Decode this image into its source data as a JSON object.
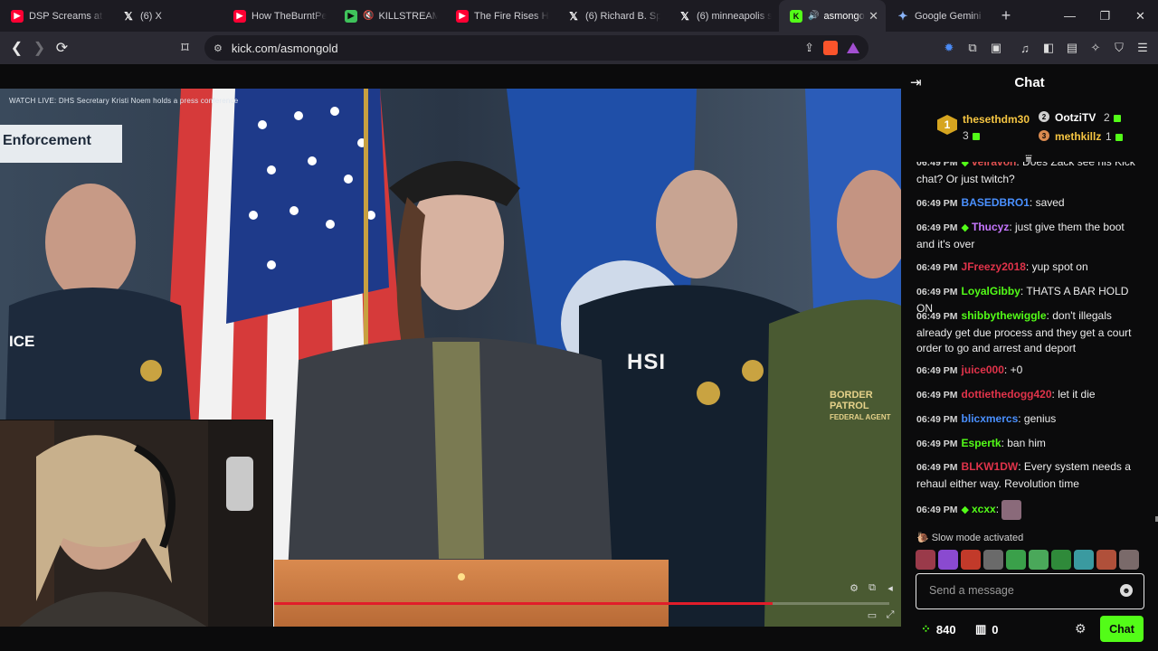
{
  "browser": {
    "tabs": [
      {
        "label": "DSP Screams at H",
        "icon": "youtube-icon"
      },
      {
        "label": "(6) X",
        "icon": "x-icon"
      },
      {
        "label": "How TheBurntPea",
        "icon": "youtube-icon"
      },
      {
        "label": "KILLSTREAM: F",
        "icon": "rumble-icon",
        "muted": true
      },
      {
        "label": "The Fire Rises HO",
        "icon": "youtube-icon"
      },
      {
        "label": "(6) Richard B. Spe",
        "icon": "x-icon"
      },
      {
        "label": "(6) minneapolis sh",
        "icon": "x-icon"
      },
      {
        "label": "asmongol",
        "icon": "kick-icon",
        "active": true
      },
      {
        "label": "Google Gemini",
        "icon": "gemini-icon"
      }
    ],
    "url": "kick.com/asmongold"
  },
  "video": {
    "live_caption": "WATCH LIVE: DHS Secretary Kristi Noem holds a press conference",
    "sign_text": "Enforcement",
    "jacket_hsi": "HSI",
    "jacket_ice": "ICE",
    "patch_line1": "BORDER PATROL",
    "patch_line2": "FEDERAL AGENT",
    "progress_percent": 81
  },
  "chat": {
    "title": "Chat",
    "leaderboard": {
      "rank": "1",
      "top_user": "thesethdm30",
      "top_count": "3",
      "second_user": "OotziTV",
      "second_count": "2",
      "third_user": "methkillz",
      "third_count": "1"
    },
    "messages": [
      {
        "time": "06:49 PM",
        "user": "veiravon",
        "user_color": "#e05050",
        "text": "Does Zack see his Kick chat? Or just twitch?",
        "sub": true
      },
      {
        "time": "06:49 PM",
        "user": "BASEDBRO1",
        "user_color": "#4a90ff",
        "text": "saved"
      },
      {
        "time": "06:49 PM",
        "user": "Thucyz",
        "user_color": "#c777ff",
        "text": "just give them the boot and it's over",
        "sub": true
      },
      {
        "time": "06:49 PM",
        "user": "JFreezy2018",
        "user_color": "#e0334a",
        "text": "yup spot on"
      },
      {
        "time": "06:49 PM",
        "user": "LoyalGibby",
        "user_color": "#53fc18",
        "text": "THATS A BAR HOLD ON"
      },
      {
        "time": "06:49 PM",
        "user": "shibbythewiggle",
        "user_color": "#53fc18",
        "text": "don't illegals already get due process and they get a court order to go and arrest and deport"
      },
      {
        "time": "06:49 PM",
        "user": "juice000",
        "user_color": "#e0334a",
        "text": "+0"
      },
      {
        "time": "06:49 PM",
        "user": "dottiethedogg420",
        "user_color": "#e0334a",
        "text": "let it die"
      },
      {
        "time": "06:49 PM",
        "user": "blicxmercs",
        "user_color": "#4a90ff",
        "text": "genius"
      },
      {
        "time": "06:49 PM",
        "user": "Espertk",
        "user_color": "#53fc18",
        "text": "ban him"
      },
      {
        "time": "06:49 PM",
        "user": "BLKW1DW",
        "user_color": "#e0334a",
        "text": "Every system needs a rehaul either way. Revolution time"
      },
      {
        "time": "06:49 PM",
        "user": "xcxx",
        "user_color": "#53fc18",
        "text": "",
        "sub": true,
        "emote": true
      }
    ],
    "slow_mode": "Slow mode activated",
    "input_placeholder": "Send a message",
    "viewers": "840",
    "gift_count": "0",
    "send_label": "Chat"
  }
}
